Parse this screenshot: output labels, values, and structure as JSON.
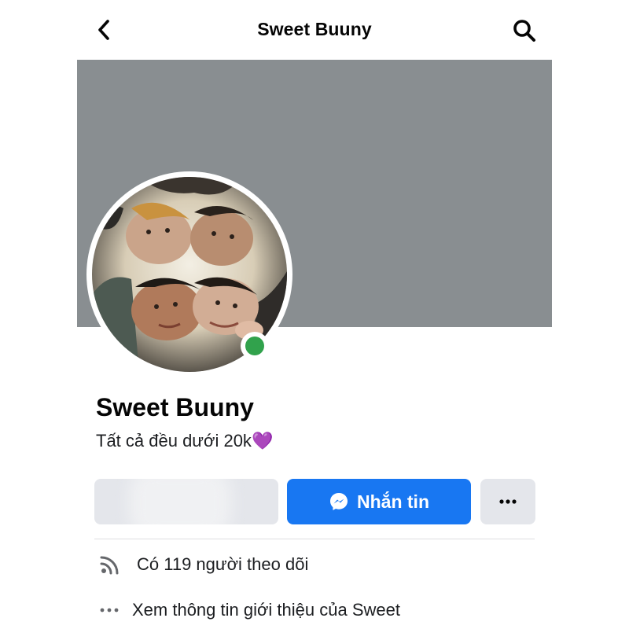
{
  "header": {
    "title": "Sweet Buuny",
    "back_icon": "chevron-left-icon",
    "search_icon": "search-icon"
  },
  "profile": {
    "name": "Sweet Buuny",
    "bio": "Tất cả đều dưới 20k",
    "bio_emoji": "💜",
    "online": true,
    "status_color": "#31a24c"
  },
  "actions": {
    "message_label": "Nhắn tin",
    "message_icon": "messenger-icon",
    "more_icon": "more-horizontal-icon",
    "primary_color": "#1877f2"
  },
  "info": {
    "followers_text": "Có 119 người theo dõi",
    "followers_icon": "rss-feed-icon",
    "about_text": "Xem thông tin giới thiệu của Sweet",
    "about_icon": "more-horizontal-icon"
  },
  "colors": {
    "cover": "#898e91",
    "button_grey": "#e4e6eb"
  }
}
